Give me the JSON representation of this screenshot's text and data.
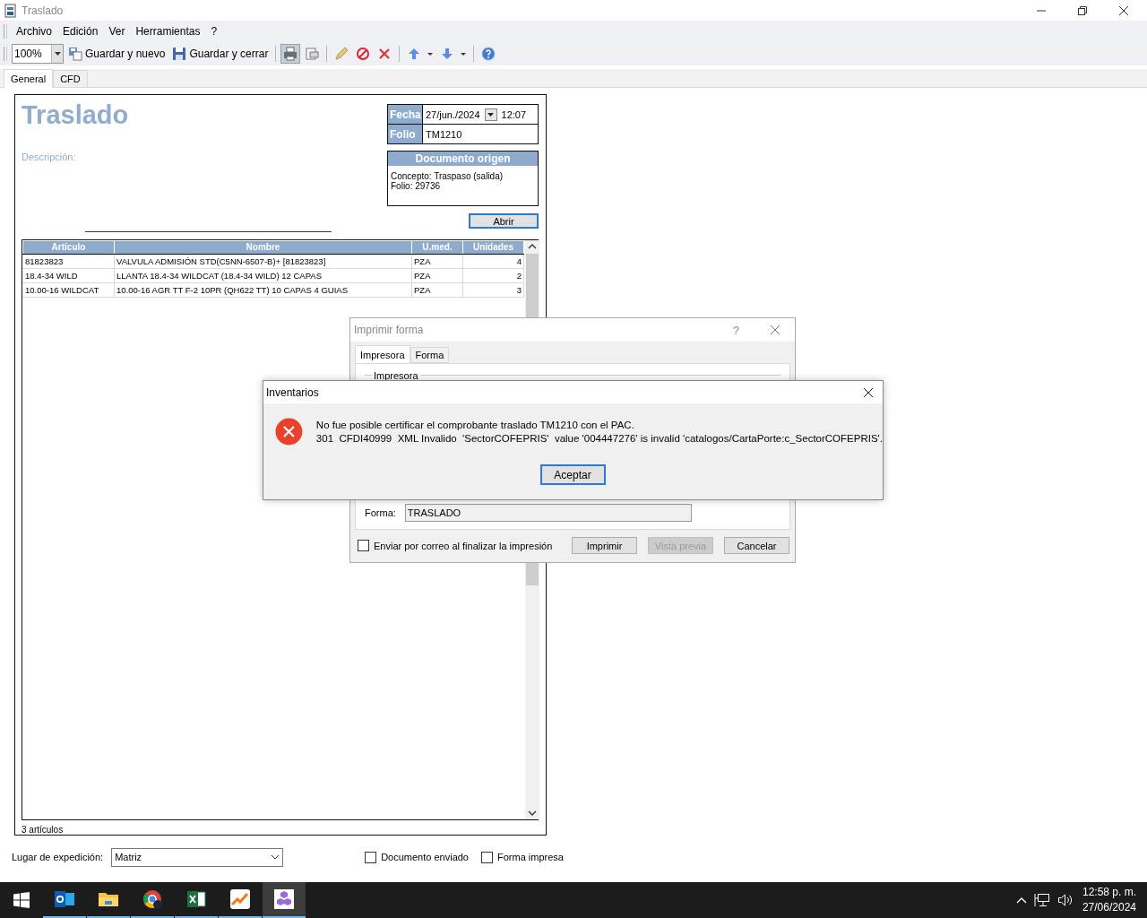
{
  "window": {
    "title": "Traslado"
  },
  "menu": [
    {
      "label": "Archivo"
    },
    {
      "label": "Edición"
    },
    {
      "label": "Ver"
    },
    {
      "label": "Herramientas"
    },
    {
      "label": "?"
    }
  ],
  "toolbar": {
    "zoom": "100%",
    "tools": [
      {
        "kind": "save_new",
        "label": "Guardar y nuevo",
        "pressed": false
      },
      {
        "kind": "save_close",
        "label": "Guardar y cerrar",
        "pressed": false
      },
      {
        "kind": "separator"
      },
      {
        "kind": "print",
        "pressed": true
      },
      {
        "kind": "preview",
        "pressed": false
      },
      {
        "kind": "separator"
      },
      {
        "kind": "edit",
        "pressed": false
      },
      {
        "kind": "cancel",
        "pressed": false
      },
      {
        "kind": "delete",
        "pressed": false
      },
      {
        "kind": "separator"
      },
      {
        "kind": "up",
        "pressed": false
      },
      {
        "kind": "down",
        "pressed": false
      },
      {
        "kind": "separator"
      },
      {
        "kind": "help",
        "pressed": false
      }
    ]
  },
  "tabs": [
    {
      "label": "General",
      "selected": true
    },
    {
      "label": "CFD",
      "selected": false
    }
  ],
  "form": {
    "title": "Traslado",
    "fecha_label": "Fecha",
    "fecha": "27/jun./2024",
    "hora": "12:07",
    "folio_label": "Folio",
    "folio": "TM1210",
    "descripcion_label": "Descripción:",
    "origen": {
      "title": "Documento origen",
      "lines": [
        "Concepto: Traspaso (salida)",
        "Folio: 29736"
      ]
    },
    "open_button": "Abrir"
  },
  "table": {
    "columns": [
      "Artículo",
      "Nombre",
      "U.med.",
      "Unidades"
    ],
    "rows": [
      [
        "81823823",
        "VALVULA ADMISIÓN STD(C5NN-6507-B)+ [81823823]",
        "PZA",
        "4"
      ],
      [
        "18.4-34 WILD",
        "LLANTA 18.4-34 WILDCAT (18.4-34 WILD) 12 CAPAS",
        "PZA",
        "2"
      ],
      [
        "10.00-16 WILDCAT",
        "10.00-16 AGR TT F-2 10PR (QH622 TT) 10 CAPAS 4 GUIAS",
        "PZA",
        "3"
      ]
    ],
    "footer": "3 artículos"
  },
  "bottom": {
    "lugar_label": "Lugar de expedición:",
    "lugar": "Matriz",
    "checkboxes": [
      {
        "label": "Documento enviado",
        "checked": false
      },
      {
        "label": "Forma impresa",
        "checked": false
      }
    ]
  },
  "print_dialog": {
    "title": "Imprimir forma",
    "help": "?",
    "tabs": [
      {
        "label": "Impresora",
        "selected": true
      },
      {
        "label": "Forma",
        "selected": false
      }
    ],
    "group": "Impresora",
    "forma_label": "Forma:",
    "forma": "TRASLADO",
    "email": {
      "label": "Enviar por correo al finalizar la impresión",
      "checked": false
    },
    "buttons": [
      {
        "label": "Imprimir",
        "disabled": false
      },
      {
        "label": "Vista previa",
        "disabled": true
      },
      {
        "label": "Cancelar",
        "disabled": false
      }
    ]
  },
  "message_box": {
    "title": "Inventarios",
    "lines": [
      "No fue posible certificar el comprobante traslado TM1210 con el PAC.",
      "301  CFDI40999  XML Invalido  'SectorCOFEPRIS'  value '004447276' is invalid 'catalogos/CartaPorte:c_SectorCOFEPRIS'."
    ],
    "button": "Aceptar"
  },
  "taskbar": {
    "apps": [
      {
        "kind": "mail",
        "selected": false
      },
      {
        "kind": "folder",
        "selected": false
      },
      {
        "kind": "browser",
        "selected": false
      },
      {
        "kind": "sheet",
        "selected": false
      },
      {
        "kind": "chart",
        "selected": false
      },
      {
        "kind": "cubes",
        "selected": true
      }
    ],
    "time": "12:58 p. m.",
    "date": "27/06/2024"
  }
}
